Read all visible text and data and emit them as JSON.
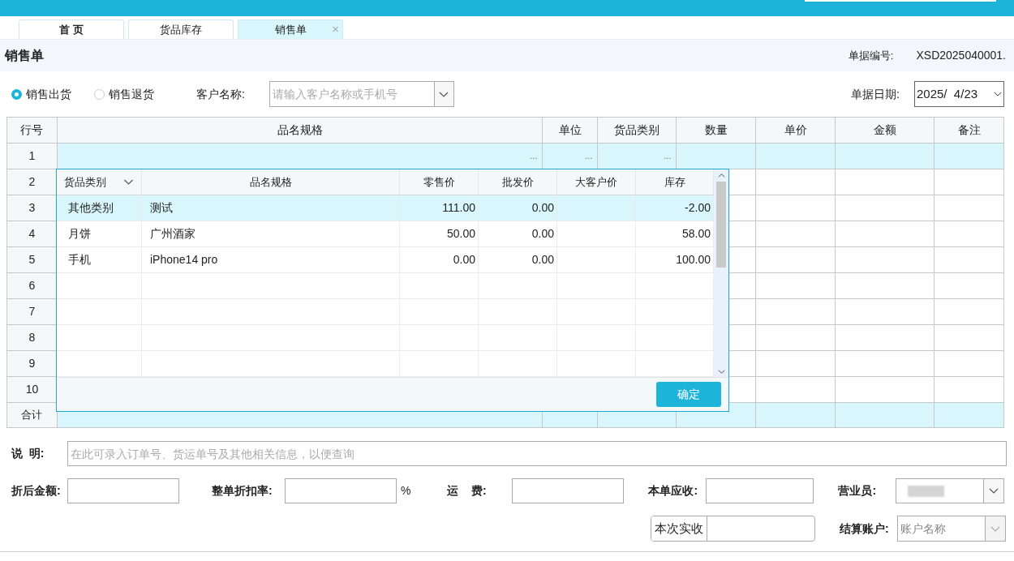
{
  "tabs": [
    {
      "label": "首 页",
      "selected": false,
      "closable": false,
      "bold": true
    },
    {
      "label": "货品库存",
      "selected": false,
      "closable": false,
      "bold": false
    },
    {
      "label": "销售单",
      "selected": true,
      "closable": true,
      "bold": false
    }
  ],
  "close_glyph": "×",
  "page_title": "销售单",
  "doc_number": {
    "label": "单据编号:",
    "value": "XSD2025040001."
  },
  "sale_types": [
    {
      "label": "销售出货",
      "selected": true
    },
    {
      "label": "销售退货",
      "selected": false
    }
  ],
  "customer": {
    "label": "客户名称:",
    "placeholder": "请输入客户名称或手机号"
  },
  "doc_date": {
    "label": "单据日期:",
    "value": "2025/  4/23"
  },
  "table": {
    "columns": [
      "行号",
      "品名规格",
      "单位",
      "货品类别",
      "数量",
      "单价",
      "金额",
      "备注"
    ],
    "rows": [
      {
        "number": "1",
        "selected": true,
        "pickers": [
          "...",
          "...",
          "..."
        ]
      },
      {
        "number": "2",
        "selected": false
      },
      {
        "number": "3",
        "selected": false
      },
      {
        "number": "4",
        "selected": false
      },
      {
        "number": "5",
        "selected": false
      },
      {
        "number": "6",
        "selected": false
      },
      {
        "number": "7",
        "selected": false
      },
      {
        "number": "8",
        "selected": false
      },
      {
        "number": "9",
        "selected": false
      },
      {
        "number": "10",
        "selected": false
      }
    ],
    "total_label": "合计"
  },
  "picker": {
    "columns": [
      "货品类别",
      "品名规格",
      "零售价",
      "批发价",
      "大客户价",
      "库存"
    ],
    "rows": [
      {
        "category": "其他类别",
        "name": "测试",
        "retail": "111.00",
        "wholesale": "0.00",
        "stock": "-2.00",
        "selected": true
      },
      {
        "category": "月饼",
        "name": "广州酒家",
        "retail": "50.00",
        "wholesale": "0.00",
        "stock": "58.00",
        "selected": false
      },
      {
        "category": "手机",
        "name": "iPhone14 pro",
        "retail": "0.00",
        "wholesale": "0.00",
        "stock": "100.00",
        "selected": false
      }
    ],
    "confirm": "确定"
  },
  "note": {
    "label": "说  明:",
    "placeholder": "在此可录入订单号、货运单号及其他相关信息，以便查询"
  },
  "discounted_amount": {
    "label": "折后金额:"
  },
  "discount_rate": {
    "label": "整单折扣率:",
    "unit": "%"
  },
  "freight": {
    "label": "运    费:"
  },
  "receivable": {
    "label": "本单应收:"
  },
  "salesperson": {
    "label": "营业员:"
  },
  "received": {
    "button": "本次实收"
  },
  "account": {
    "label": "结算账户:",
    "placeholder": "账户名称"
  }
}
